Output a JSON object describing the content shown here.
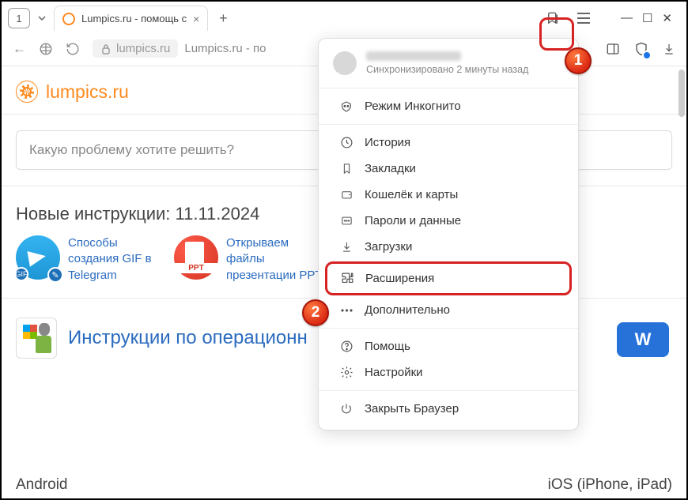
{
  "tab": {
    "count": "1",
    "title": "Lumpics.ru - помощь с"
  },
  "url": {
    "domain": "lumpics.ru",
    "rest": "Lumpics.ru - по"
  },
  "site": {
    "name": "lumpics.ru"
  },
  "search": {
    "placeholder": "Какую проблему хотите решить?"
  },
  "section_title": "Новые инструкции: 11.11.2024",
  "articles": [
    {
      "title": "Способы создания GIF в Telegram"
    },
    {
      "title": "Открываем файлы презентации PPT"
    }
  ],
  "os_section": {
    "title": "Инструкции по операционн"
  },
  "bottom": {
    "left": "Android",
    "right": "iOS (iPhone, iPad)"
  },
  "vk": "W",
  "menu": {
    "sync_status": "Синхронизировано 2 минуты назад",
    "items": {
      "incognito": "Режим Инкогнито",
      "history": "История",
      "bookmarks": "Закладки",
      "wallet": "Кошелёк и карты",
      "passwords": "Пароли и данные",
      "downloads": "Загрузки",
      "extensions": "Расширения",
      "more": "Дополнительно",
      "help": "Помощь",
      "settings": "Настройки",
      "close": "Закрыть Браузер"
    }
  },
  "callouts": {
    "one": "1",
    "two": "2"
  }
}
